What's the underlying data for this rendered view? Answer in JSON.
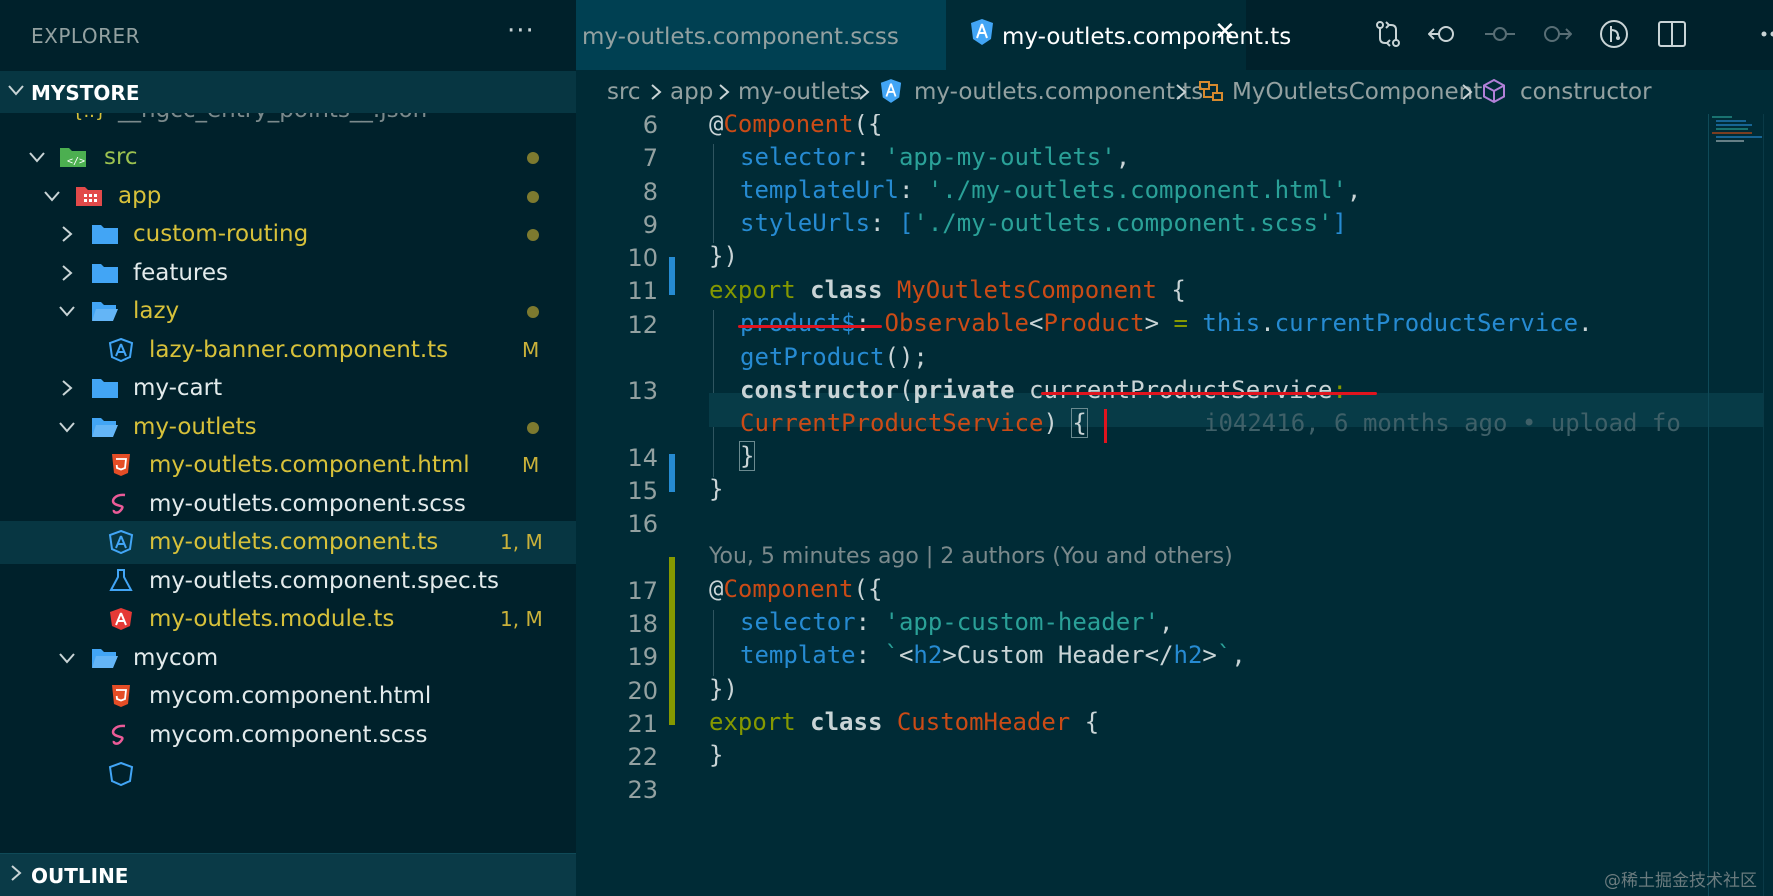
{
  "sidebar": {
    "title": "EXPLORER",
    "more": "···",
    "root": "MYSTORE",
    "outline": "OUTLINE",
    "items": [
      {
        "label": "__ngcc_entry_points__.json",
        "badge": ""
      },
      {
        "label": "src",
        "badge": ""
      },
      {
        "label": "app",
        "badge": ""
      },
      {
        "label": "custom-routing",
        "badge": ""
      },
      {
        "label": "features",
        "badge": ""
      },
      {
        "label": "lazy",
        "badge": ""
      },
      {
        "label": "lazy-banner.component.ts",
        "badge": "M"
      },
      {
        "label": "my-cart",
        "badge": ""
      },
      {
        "label": "my-outlets",
        "badge": ""
      },
      {
        "label": "my-outlets.component.html",
        "badge": "M"
      },
      {
        "label": "my-outlets.component.scss",
        "badge": ""
      },
      {
        "label": "my-outlets.component.ts",
        "badge": "1, M"
      },
      {
        "label": "my-outlets.component.spec.ts",
        "badge": ""
      },
      {
        "label": "my-outlets.module.ts",
        "badge": "1, M"
      },
      {
        "label": "mycom",
        "badge": ""
      },
      {
        "label": "mycom.component.html",
        "badge": ""
      },
      {
        "label": "mycom.component.scss",
        "badge": ""
      }
    ]
  },
  "tabs": [
    {
      "label": "my-outlets.component.scss"
    },
    {
      "label": "my-outlets.component.ts",
      "close": "✕"
    }
  ],
  "toolbar": [
    "git-compare-icon",
    "go-back-icon",
    "git-commit-icon",
    "go-forward-icon",
    "git-history-icon",
    "split-editor-icon"
  ],
  "breadcrumb": [
    "src",
    "app",
    "my-outlets",
    "my-outlets.component.ts",
    "MyOutletsComponent",
    "constructor"
  ],
  "editor": {
    "line_numbers": [
      "6",
      "7",
      "8",
      "9",
      "10",
      "11",
      "12",
      "13",
      "14",
      "15",
      "16",
      "17",
      "18",
      "19",
      "20",
      "21",
      "22",
      "23"
    ],
    "codelens": "You, 5 minutes ago | 2 authors (You and others)",
    "blame": "i042416, 6 months ago • upload fo",
    "code": {
      "l6_at": "@",
      "l6_dec": "Component",
      "l6_p": "({",
      "l7_prop": "selector",
      "l7_c": ": ",
      "l7_str": "'app-my-outlets'",
      "l7_e": ",",
      "l8_prop": "templateUrl",
      "l8_c": ": ",
      "l8_str": "'./my-outlets.component.html'",
      "l8_e": ",",
      "l9_prop": "styleUrls",
      "l9_c": ": ",
      "l9_b1": "[",
      "l9_str": "'./my-outlets.component.scss'",
      "l9_b2": "]",
      "l10": "})",
      "l11_kw": "export",
      "l11_kw2": "class",
      "l11_cls": "MyOutletsComponent",
      "l11_e": " {",
      "l12_prop": "product$",
      "l12_c": ": ",
      "l12_t1": "Observable",
      "l12_lt": "<",
      "l12_t2": "Product",
      "l12_gt": ">",
      "l12_eq": " = ",
      "l12_this": "this",
      "l12_dot": ".",
      "l12_svc": "currentProductService",
      "l12_end": ".",
      "l12b_fn": "getProduct",
      "l12b_e": "();",
      "l13_ctor": "constructor",
      "l13_p": "(",
      "l13_priv": "private",
      "l13_param": "currentProductService",
      "l13_c": ":",
      "l13b_type": "CurrentProductService",
      "l13b_e": ") ",
      "l13b_br": "{",
      "l14": "}",
      "l15": "}",
      "l17_at": "@",
      "l17_dec": "Component",
      "l17_p": "({",
      "l18_prop": "selector",
      "l18_c": ": ",
      "l18_str": "'app-custom-header'",
      "l18_e": ",",
      "l19_prop": "template",
      "l19_c": ": ",
      "l19_bt": "`",
      "l19_lt": "<",
      "l19_tag": "h2",
      "l19_gt": ">",
      "l19_txt": "Custom Header",
      "l19_lt2": "</",
      "l19_tag2": "h2",
      "l19_gt2": ">",
      "l19_bt2": "`",
      "l19_e": ",",
      "l20": "})",
      "l21_kw": "export",
      "l21_kw2": "class",
      "l21_cls": "CustomHeader",
      "l21_e": " {",
      "l22": "}"
    }
  },
  "watermark": "@稀土掘金技术社区",
  "colors": {
    "background": "#002b36",
    "sidebar": "#00212b",
    "selection": "#073642",
    "underline": "#e0141e"
  }
}
